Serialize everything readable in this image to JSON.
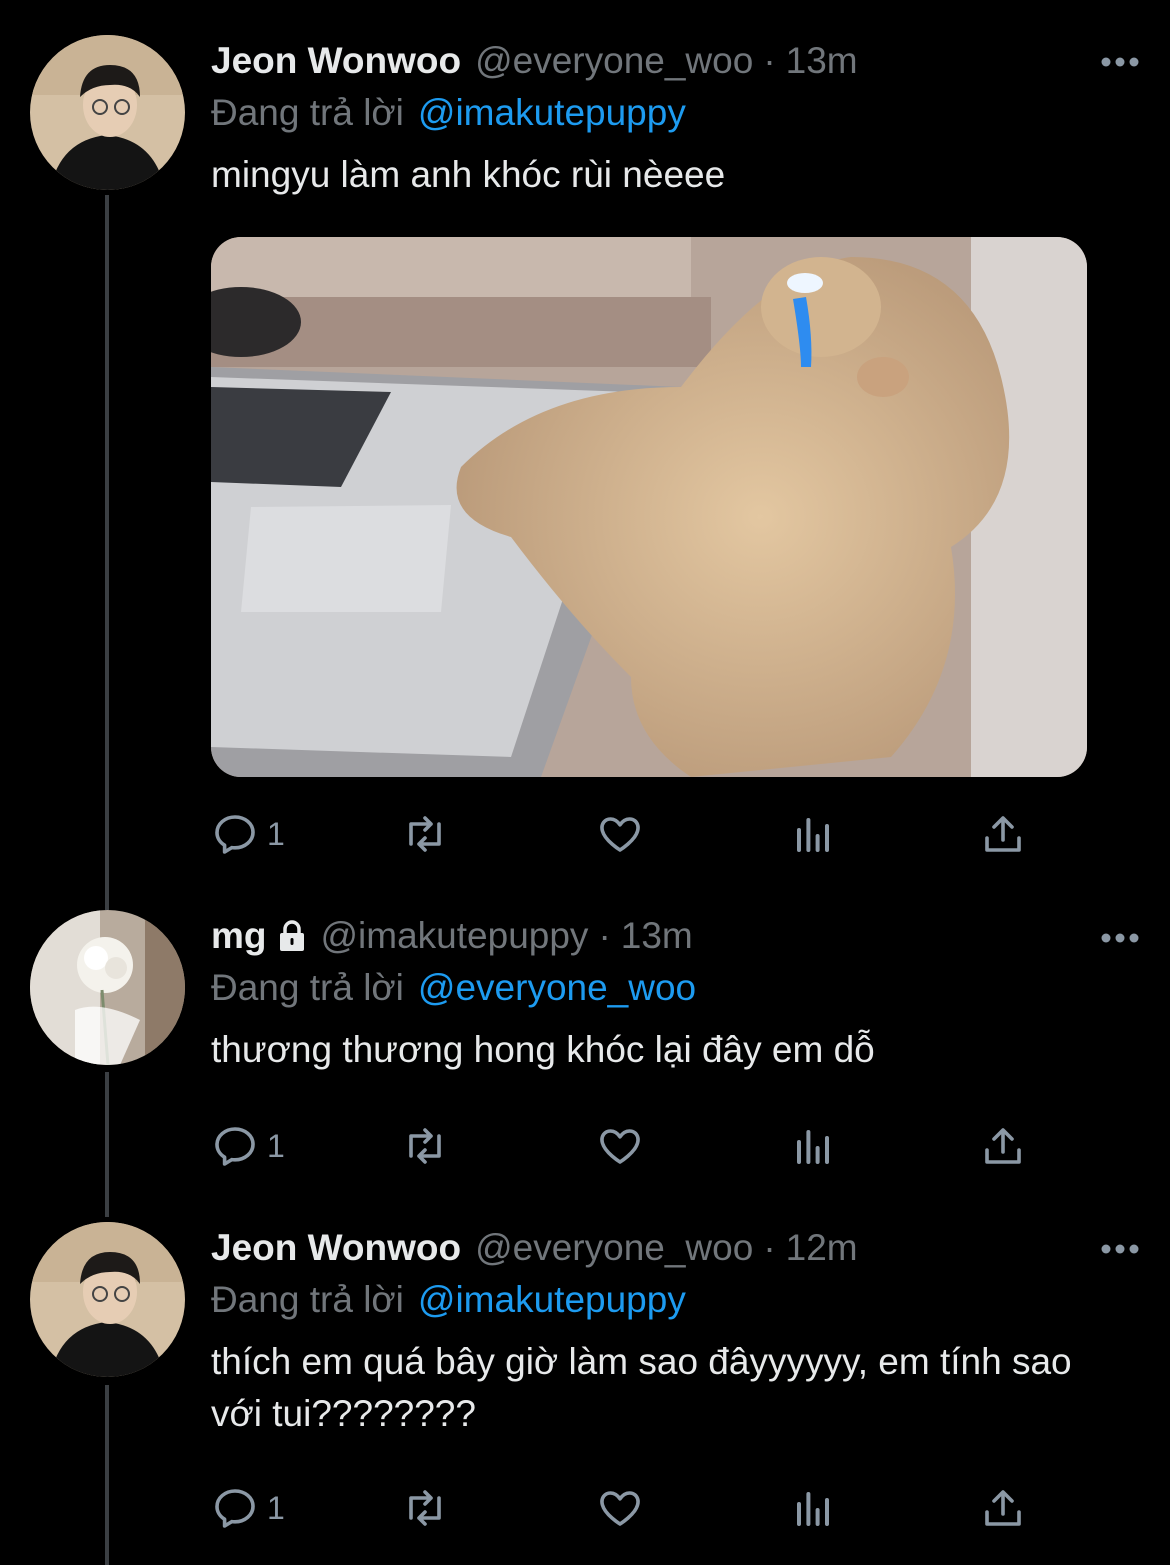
{
  "tweets": [
    {
      "display_name": "Jeon Wonwoo",
      "handle": "@everyone_woo",
      "separator": "·",
      "time": "13m",
      "reply_label": "Đang trả lời",
      "reply_to": "@imakutepuppy",
      "text": "mingyu làm anh khóc rùi nèeee",
      "reply_count": "1",
      "locked": false,
      "has_media": true
    },
    {
      "display_name": "mg",
      "handle": "@imakutepuppy",
      "separator": "·",
      "time": "13m",
      "reply_label": "Đang trả lời",
      "reply_to": "@everyone_woo",
      "text": "thương thương hong khóc lại đây em dỗ",
      "reply_count": "1",
      "locked": true,
      "has_media": false
    },
    {
      "display_name": "Jeon Wonwoo",
      "handle": "@everyone_woo",
      "separator": "·",
      "time": "12m",
      "reply_label": "Đang trả lời",
      "reply_to": "@imakutepuppy",
      "text": "thích em quá bây giờ làm sao đâyyyyyy, em tính sao với tui????????",
      "reply_count": "1",
      "locked": false,
      "has_media": false
    }
  ],
  "colors": {
    "background": "#000000",
    "text_primary": "#e7e9ea",
    "text_secondary": "#71767b",
    "link": "#1d9bf0",
    "icon": "#8b98a5",
    "thread_line": "#3b3f43"
  },
  "icons": {
    "reply": "reply-icon",
    "retweet": "retweet-icon",
    "like": "heart-icon",
    "views": "analytics-icon",
    "share": "share-icon",
    "more": "more-icon",
    "lock": "lock-icon"
  }
}
